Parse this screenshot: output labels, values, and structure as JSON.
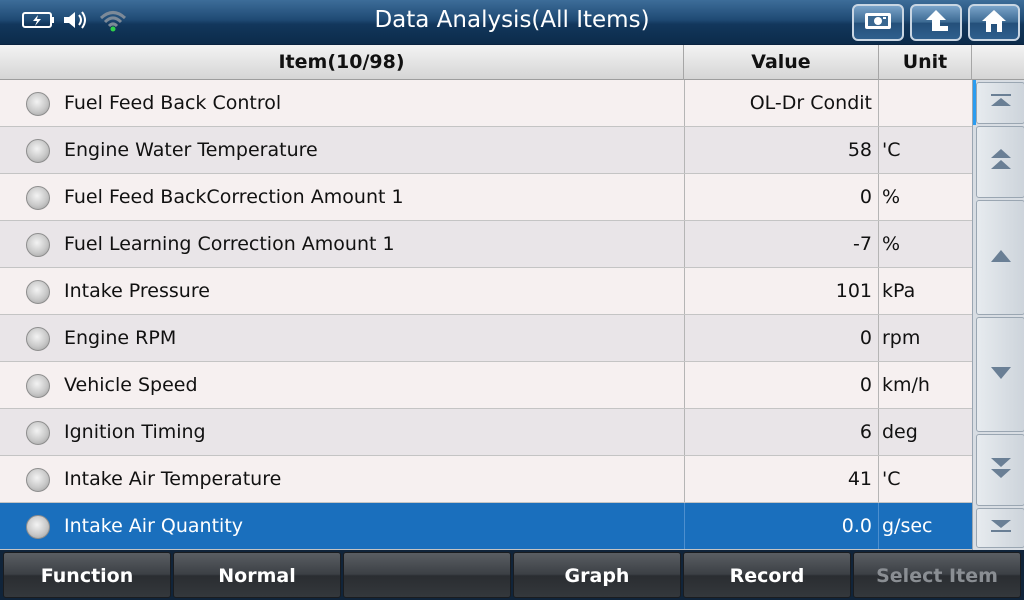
{
  "header": {
    "title": "Data Analysis(All Items)"
  },
  "status_icons": [
    "battery-charging-icon",
    "speaker-icon",
    "wifi-icon"
  ],
  "top_buttons": [
    "screenshot-icon",
    "back-arrow-icon",
    "home-icon"
  ],
  "table": {
    "headers": {
      "item": "Item(10/98)",
      "value": "Value",
      "unit": "Unit"
    },
    "rows": [
      {
        "name": "Fuel Feed Back Control",
        "value": "OL-Dr Condit",
        "unit": ""
      },
      {
        "name": "Engine Water Temperature",
        "value": "58",
        "unit": "'C"
      },
      {
        "name": "Fuel Feed BackCorrection Amount 1",
        "value": "0",
        "unit": "%"
      },
      {
        "name": "Fuel Learning Correction Amount 1",
        "value": "-7",
        "unit": "%"
      },
      {
        "name": "Intake Pressure",
        "value": "101",
        "unit": "kPa"
      },
      {
        "name": "Engine RPM",
        "value": "0",
        "unit": "rpm"
      },
      {
        "name": "Vehicle Speed",
        "value": "0",
        "unit": "km/h"
      },
      {
        "name": "Ignition Timing",
        "value": "6",
        "unit": "deg"
      },
      {
        "name": "Intake Air Temperature",
        "value": "41",
        "unit": "'C"
      },
      {
        "name": "Intake Air Quantity",
        "value": "0.0",
        "unit": "g/sec"
      }
    ],
    "selected_index": 9
  },
  "scroll_buttons": [
    "scroll-top-icon",
    "page-up-icon",
    "line-up-icon",
    "line-down-icon",
    "page-down-icon",
    "scroll-bottom-icon"
  ],
  "bottom_bar": {
    "buttons": [
      {
        "label": "Function",
        "enabled": true
      },
      {
        "label": "Normal",
        "enabled": true
      },
      {
        "label": "",
        "enabled": true
      },
      {
        "label": "Graph",
        "enabled": true
      },
      {
        "label": "Record",
        "enabled": true
      },
      {
        "label": "Select Item",
        "enabled": false
      }
    ]
  },
  "colors": {
    "selected_row": "#1a6fbd",
    "title_bar": "#1f4a74"
  }
}
